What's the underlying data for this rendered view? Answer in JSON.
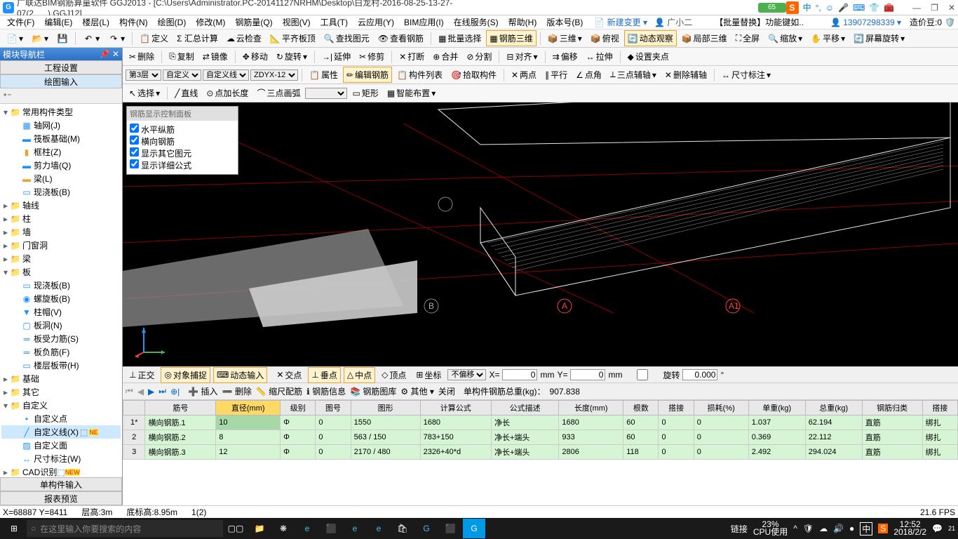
{
  "title": "广联达BIM钢筋算量软件 GGJ2013 - [C:\\Users\\Administrator.PC-20141127NRHM\\Desktop\\白龙村-2016-08-25-13-27-07(2___).GGJ12]",
  "progress_badge": "65",
  "ime_indicator": "中",
  "user_bar": {
    "new_change": "新建变更",
    "agent": "广小二",
    "batch_replace": "【批量替换】功能键如..",
    "phone": "13907298339",
    "coin_label": "造价豆:0"
  },
  "menus": [
    "文件(F)",
    "编辑(E)",
    "楼层(L)",
    "构件(N)",
    "绘图(D)",
    "修改(M)",
    "钢筋量(Q)",
    "视图(V)",
    "工具(T)",
    "云应用(Y)",
    "BIM应用(I)",
    "在线服务(S)",
    "帮助(H)",
    "版本号(B)"
  ],
  "toolbar1": {
    "define": "定义",
    "sum": "Σ 汇总计算",
    "cloud": "云检查",
    "flat": "平齐板顶",
    "find": "查找图元",
    "view_rebar": "查看钢筋",
    "batch_select": "批量选择",
    "rebar_3d": "钢筋三维",
    "three_d": "三维",
    "bird": "俯视",
    "dynamic": "动态观察",
    "local_3d": "局部三维",
    "fullscreen": "全屏",
    "zoom": "缩放",
    "pan": "平移",
    "rotate_screen": "屏幕旋转"
  },
  "toolbar2": {
    "delete": "删除",
    "copy": "复制",
    "mirror": "镜像",
    "move": "移动",
    "rotate": "旋转",
    "extend": "延伸",
    "trim": "修剪",
    "break": "打断",
    "merge": "合并",
    "split": "分割",
    "align": "对齐",
    "offset": "偏移",
    "stretch": "拉伸",
    "set_clamp": "设置夹点"
  },
  "toolbar3": {
    "floor": "第3层",
    "custom": "自定义",
    "custom_line": "自定义线",
    "zdyx": "ZDYX-12",
    "attr": "属性",
    "edit_rebar": "编辑钢筋",
    "comp_list": "构件列表",
    "pick_comp": "拾取构件",
    "two_point": "两点",
    "parallel": "平行",
    "angle": "点角",
    "three_axis": "三点辅轴",
    "delete_axis": "删除辅轴",
    "dim": "尺寸标注"
  },
  "toolbar4": {
    "select": "选择",
    "line": "直线",
    "point_len": "点加长度",
    "three_arc": "三点画弧",
    "rect": "矩形",
    "smart": "智能布置"
  },
  "sidebar": {
    "header": "模块导航栏",
    "tab1": "工程设置",
    "tab2": "绘图输入",
    "tree": {
      "root": "常用构件类型",
      "items": [
        "轴网(J)",
        "筏板基础(M)",
        "框柱(Z)",
        "剪力墙(Q)",
        "梁(L)",
        "现浇板(B)"
      ],
      "groups": [
        "轴线",
        "柱",
        "墙",
        "门窗洞",
        "梁",
        "板",
        "基础",
        "其它",
        "自定义",
        "CAD识别"
      ],
      "slab_items": [
        "现浇板(B)",
        "螺旋板(B)",
        "柱帽(V)",
        "板洞(N)",
        "板受力筋(S)",
        "板负筋(F)",
        "楼层板带(H)"
      ],
      "custom_items": [
        "自定义点",
        "自定义线(X)",
        "自定义面",
        "尺寸标注(W)"
      ]
    },
    "footer1": "单构件输入",
    "footer2": "报表预览"
  },
  "floating_panel": {
    "title": "钢筋显示控制面板",
    "checks": [
      "水平纵筋",
      "横向钢筋",
      "显示其它图元",
      "显示详细公式"
    ]
  },
  "snap_bar": {
    "ortho": "正交",
    "osnap": "对象捕捉",
    "dyn_input": "动态输入",
    "cross": "交点",
    "perp": "垂点",
    "mid": "中点",
    "vertex": "顶点",
    "coord": "坐标",
    "no_offset": "不偏移",
    "x": "X=",
    "x_val": "0",
    "mm1": "mm",
    "y": "Y=",
    "y_val": "0",
    "mm2": "mm",
    "rot": "旋转",
    "rot_val": "0.000"
  },
  "data_toolbar": {
    "insert": "插入",
    "delete": "删除",
    "scale": "缩尺配筋",
    "info": "钢筋信息",
    "library": "钢筋图库",
    "other": "其他",
    "close": "关闭",
    "total_label": "单构件钢筋总重(kg)：",
    "total_val": "907.838"
  },
  "grid": {
    "headers": [
      "",
      "筋号",
      "直径(mm)",
      "级别",
      "图号",
      "图形",
      "计算公式",
      "公式描述",
      "长度(mm)",
      "根数",
      "搭接",
      "损耗(%)",
      "单重(kg)",
      "总重(kg)",
      "钢筋归类",
      "搭接"
    ],
    "rows": [
      {
        "n": "1*",
        "name": "横向钢筋.1",
        "dia": "10",
        "lvl": "Φ",
        "fig": "0",
        "shape": "1550",
        "calc": "1680",
        "desc": "净长",
        "len": "1680",
        "cnt": "60",
        "lap": "0",
        "loss": "0",
        "uw": "1.037",
        "tw": "62.194",
        "cat": "直筋",
        "lap2": "绑扎"
      },
      {
        "n": "2",
        "name": "横向钢筋.2",
        "dia": "8",
        "lvl": "Φ",
        "fig": "0",
        "shape": "563 / 150",
        "calc": "783+150",
        "desc": "净长+端头",
        "len": "933",
        "cnt": "60",
        "lap": "0",
        "loss": "0",
        "uw": "0.369",
        "tw": "22.112",
        "cat": "直筋",
        "lap2": "绑扎"
      },
      {
        "n": "3",
        "name": "横向钢筋.3",
        "dia": "12",
        "lvl": "Φ",
        "fig": "0",
        "shape": "2170 / 480",
        "calc": "2326+40*d",
        "desc": "净长+端头",
        "len": "2806",
        "cnt": "118",
        "lap": "0",
        "loss": "0",
        "uw": "2.492",
        "tw": "294.024",
        "cat": "直筋",
        "lap2": "绑扎"
      }
    ]
  },
  "statusbar": {
    "coords": "X=68887 Y=8411",
    "floor": "层高:3m",
    "bottom": "底标高:8.95m",
    "sel": "1(2)",
    "fps": "21.6 FPS"
  },
  "taskbar": {
    "search_placeholder": "在这里输入你要搜索的内容",
    "link": "链接",
    "cpu": "23%",
    "cpu_label": "CPU使用",
    "time": "12:52",
    "date": "2018/2/2",
    "ime": "中"
  }
}
